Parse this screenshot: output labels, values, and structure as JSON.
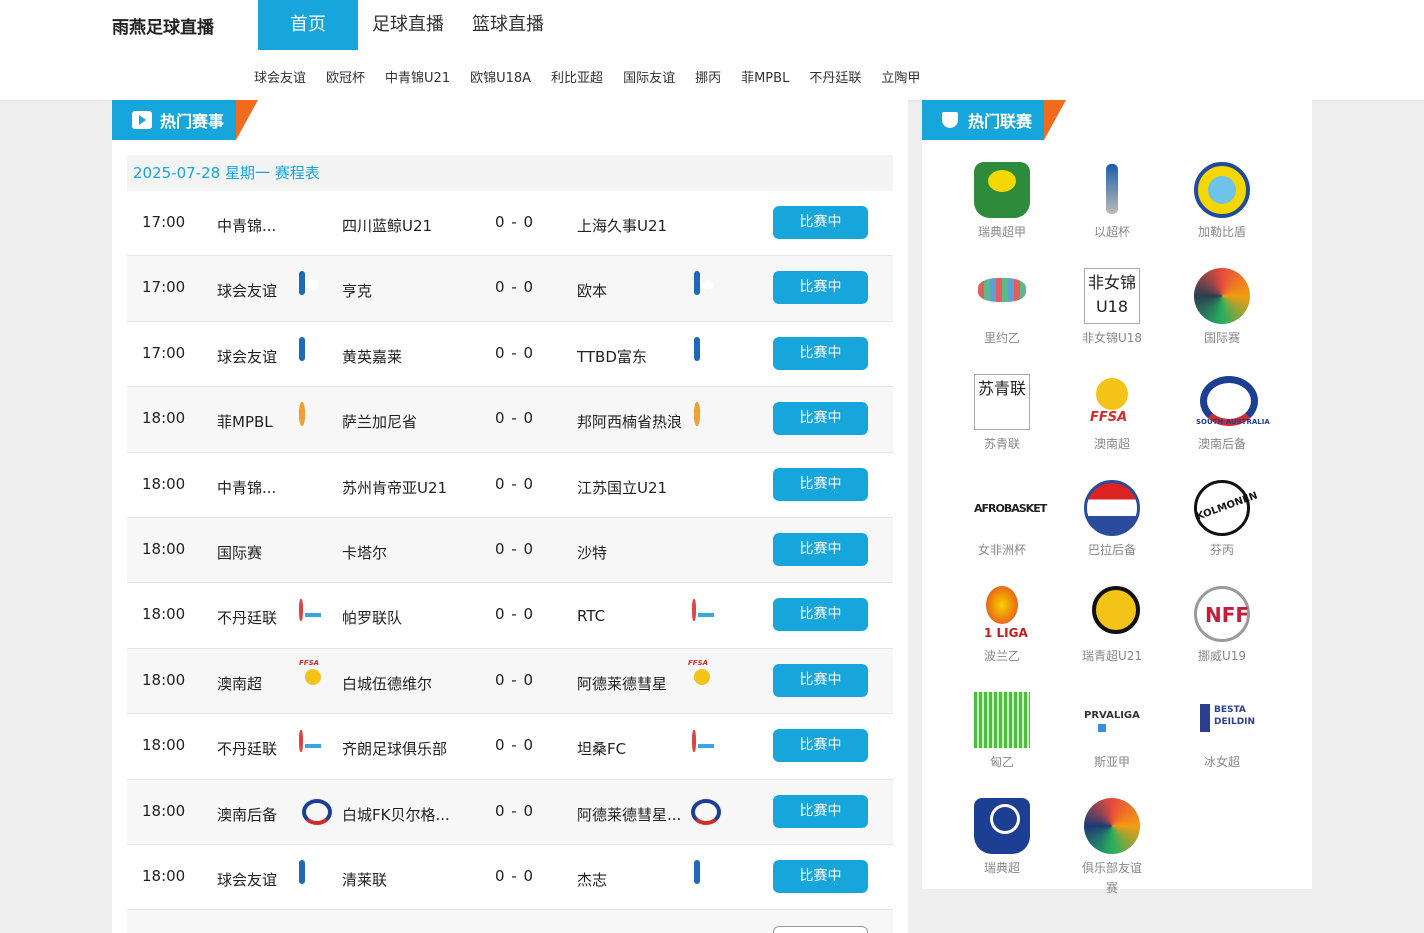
{
  "brand": "雨燕足球直播",
  "nav": [
    {
      "label": "首页",
      "active": true
    },
    {
      "label": "足球直播",
      "active": false
    },
    {
      "label": "篮球直播",
      "active": false
    }
  ],
  "subnav": [
    "球会友谊",
    "欧冠杯",
    "中青锦U21",
    "欧锦U18A",
    "利比亚超",
    "国际友谊",
    "挪丙",
    "菲MPBL",
    "不丹廷联",
    "立陶甲"
  ],
  "hot_matches": {
    "title": "热门赛事",
    "date_line": "2025-07-28 星期一 赛程表",
    "matches": [
      {
        "time": "17:00",
        "league": "中青锦...",
        "home": "四川蓝鲸U21",
        "score": "0 - 0",
        "away": "上海久事U21",
        "status": "比赛中",
        "logo": "cybl"
      },
      {
        "time": "17:00",
        "league": "球会友谊",
        "home": "亨克",
        "score": "0 - 0",
        "away": "欧本",
        "status": "比赛中",
        "logo": "friend"
      },
      {
        "time": "17:00",
        "league": "球会友谊",
        "home": "黄英嘉莱",
        "score": "0 - 0",
        "away": "TTBD富东",
        "status": "比赛中",
        "logo": "friend"
      },
      {
        "time": "18:00",
        "league": "菲MPBL",
        "home": "萨兰加尼省",
        "score": "0 - 0",
        "away": "邦阿西楠省热浪",
        "status": "比赛中",
        "logo": "mpbl"
      },
      {
        "time": "18:00",
        "league": "中青锦...",
        "home": "苏州肯帝亚U21",
        "score": "0 - 0",
        "away": "江苏国立U21",
        "status": "比赛中",
        "logo": "cybl"
      },
      {
        "time": "18:00",
        "league": "国际赛",
        "home": "卡塔尔",
        "score": "0 - 0",
        "away": "沙特",
        "status": "比赛中",
        "logo": "world"
      },
      {
        "time": "18:00",
        "league": "不丹廷联",
        "home": "帕罗联队",
        "score": "0 - 0",
        "away": "RTC",
        "status": "比赛中",
        "logo": "bhutan"
      },
      {
        "time": "18:00",
        "league": "澳南超",
        "home": "白城伍德维尔",
        "score": "0 - 0",
        "away": "阿德莱德彗星",
        "status": "比赛中",
        "logo": "ffsa"
      },
      {
        "time": "18:00",
        "league": "不丹廷联",
        "home": "齐朗足球俱乐部",
        "score": "0 - 0",
        "away": "坦桑FC",
        "status": "比赛中",
        "logo": "bhutan"
      },
      {
        "time": "18:00",
        "league": "澳南后备",
        "home": "白城FK贝尔格...",
        "score": "0 - 0",
        "away": "阿德莱德彗星...",
        "status": "比赛中",
        "logo": "fsa"
      },
      {
        "time": "18:00",
        "league": "球会友谊",
        "home": "清莱联",
        "score": "0 - 0",
        "away": "杰志",
        "status": "比赛中",
        "logo": "friend"
      }
    ]
  },
  "hot_leagues": {
    "title": "热门联赛",
    "items": [
      {
        "name": "瑞典超甲",
        "logo": "superettan"
      },
      {
        "name": "以超杯",
        "logo": "israel"
      },
      {
        "name": "加勒比盾",
        "logo": "caribe"
      },
      {
        "name": "里约乙",
        "logo": "rio"
      },
      {
        "name": "非女锦U18",
        "logo": "broken",
        "alt": "非女锦U18"
      },
      {
        "name": "国际赛",
        "logo": "world"
      },
      {
        "name": "苏青联",
        "logo": "broken",
        "alt": "苏青联"
      },
      {
        "name": "澳南超",
        "logo": "ffsa"
      },
      {
        "name": "澳南后备",
        "logo": "fsa"
      },
      {
        "name": "女非洲杯",
        "logo": "afro"
      },
      {
        "name": "巴拉后备",
        "logo": "parag"
      },
      {
        "name": "芬丙",
        "logo": "kolm"
      },
      {
        "name": "波兰乙",
        "logo": "liga"
      },
      {
        "name": "瑞青超U21",
        "logo": "allsv"
      },
      {
        "name": "挪威U19",
        "logo": "nff"
      },
      {
        "name": "匈乙",
        "logo": "green"
      },
      {
        "name": "斯亚甲",
        "logo": "prva"
      },
      {
        "name": "冰女超",
        "logo": "besta"
      },
      {
        "name": "瑞典超",
        "logo": "allsv2"
      },
      {
        "name": "俱乐部友谊赛",
        "logo": "club"
      }
    ]
  },
  "colors": {
    "accent": "#16a6dc",
    "orange": "#f26b1d"
  }
}
